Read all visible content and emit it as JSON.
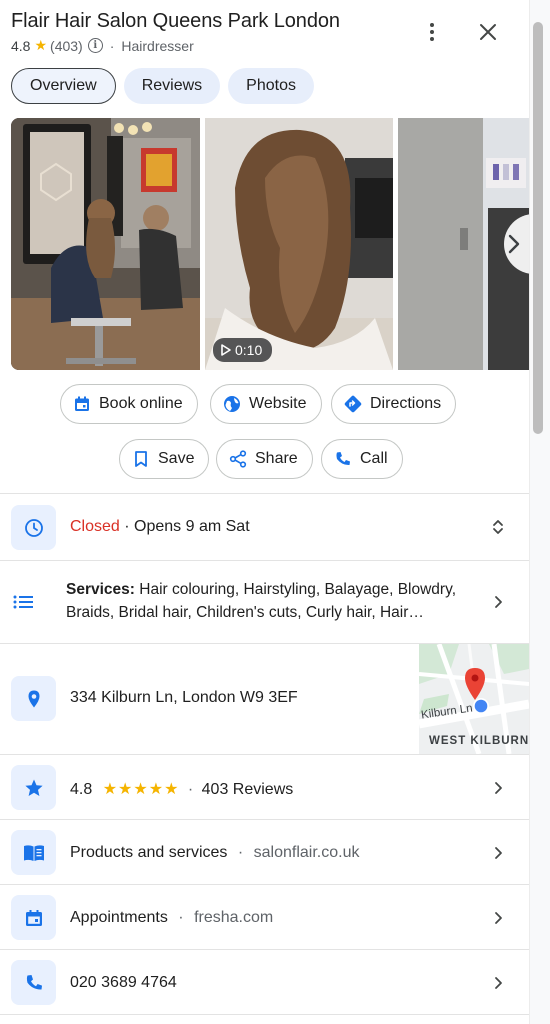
{
  "header": {
    "title": "Flair Hair Salon Queens Park London",
    "rating": "4.8",
    "review_count": "(403)",
    "info_icon": "i",
    "category": "Hairdresser"
  },
  "tabs": [
    {
      "label": "Overview",
      "active": true
    },
    {
      "label": "Reviews",
      "active": false
    },
    {
      "label": "Photos",
      "active": false
    }
  ],
  "photos": {
    "video_duration": "0:10"
  },
  "actions": {
    "book_online": "Book online",
    "website": "Website",
    "directions": "Directions",
    "save": "Save",
    "share": "Share",
    "call": "Call"
  },
  "hours": {
    "status": "Closed",
    "separator": " · ",
    "next": "Opens 9 am Sat"
  },
  "services": {
    "label": "Services:",
    "list": " Hair colouring, Hairstyling, Balayage, Blowdry, Braids, Bridal hair, Children's cuts, Curly hair, Hair…"
  },
  "address": {
    "text": "334 Kilburn Ln, London W9 3EF",
    "map_street_label": "Kilburn Ln",
    "map_area_label": "WEST KILBURN"
  },
  "reviews_row": {
    "rating": "4.8",
    "stars": "★★★★★",
    "separator": "·",
    "count": "403 Reviews"
  },
  "products_row": {
    "label": "Products and services",
    "separator": "·",
    "domain": "salonflair.co.uk"
  },
  "appointments_row": {
    "label": "Appointments",
    "separator": "·",
    "domain": "fresha.com"
  },
  "phone_row": {
    "number": "020 3689 4764"
  },
  "colors": {
    "accent_blue": "#1a73e8",
    "closed_red": "#d93025",
    "star_yellow": "#f5b400",
    "icon_bg": "#e8f0fe",
    "map_pin_red": "#ea4335"
  }
}
